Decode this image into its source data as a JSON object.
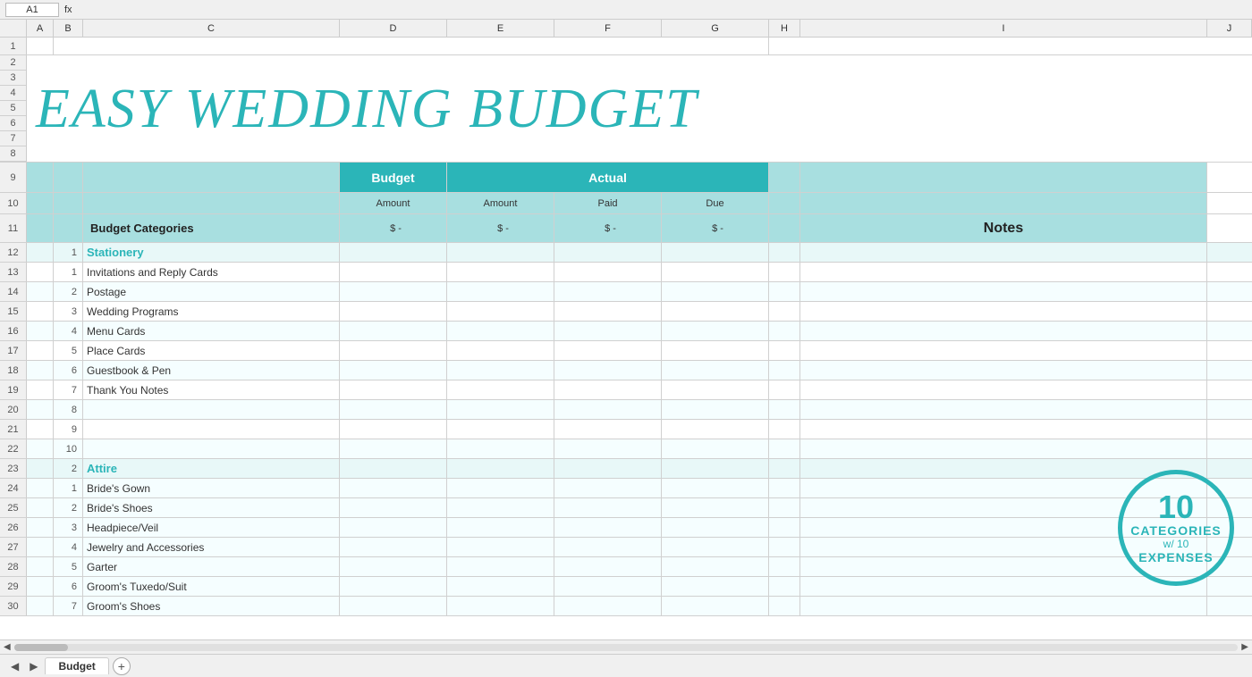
{
  "title": "EASY WEDDING BUDGET",
  "header": {
    "budget_col": "Budget",
    "actual_col": "Actual",
    "budget_amount": "Amount",
    "actual_amount": "Amount",
    "actual_paid": "Paid",
    "actual_due": "Due",
    "budget_categories": "Budget Categories",
    "notes": "Notes",
    "dollar_dash": "$ -"
  },
  "categories": [
    {
      "num": "1",
      "name": "Stationery",
      "items": [
        {
          "num": "1",
          "name": "Invitations and Reply Cards"
        },
        {
          "num": "2",
          "name": "Postage"
        },
        {
          "num": "3",
          "name": "Wedding Programs"
        },
        {
          "num": "4",
          "name": "Menu Cards"
        },
        {
          "num": "5",
          "name": "Place Cards"
        },
        {
          "num": "6",
          "name": "Guestbook & Pen"
        },
        {
          "num": "7",
          "name": "Thank You Notes"
        },
        {
          "num": "8",
          "name": ""
        },
        {
          "num": "9",
          "name": ""
        },
        {
          "num": "10",
          "name": ""
        }
      ]
    },
    {
      "num": "2",
      "name": "Attire",
      "items": [
        {
          "num": "1",
          "name": "Bride's Gown"
        },
        {
          "num": "2",
          "name": "Bride's Shoes"
        },
        {
          "num": "3",
          "name": "Headpiece/Veil"
        },
        {
          "num": "4",
          "name": "Jewelry and Accessories"
        },
        {
          "num": "5",
          "name": "Garter"
        },
        {
          "num": "6",
          "name": "Groom's Tuxedo/Suit"
        },
        {
          "num": "7",
          "name": "Groom's Shoes"
        }
      ]
    }
  ],
  "badge": {
    "num": "10",
    "line1": "CATEGORIES",
    "line2": "w/ 10",
    "line3": "EXPENSES"
  },
  "tabs": [
    {
      "label": "Budget",
      "active": true
    }
  ],
  "col_headers": [
    "A",
    "B",
    "C",
    "D",
    "E",
    "F",
    "G",
    "H",
    "I",
    "J"
  ],
  "row_numbers": [
    "1",
    "2",
    "3",
    "4",
    "5",
    "6",
    "7",
    "8",
    "9",
    "10",
    "11",
    "12",
    "13",
    "14",
    "15",
    "16",
    "17",
    "18",
    "19",
    "20",
    "21",
    "22",
    "23",
    "24",
    "25",
    "26",
    "27",
    "28",
    "29",
    "30"
  ]
}
